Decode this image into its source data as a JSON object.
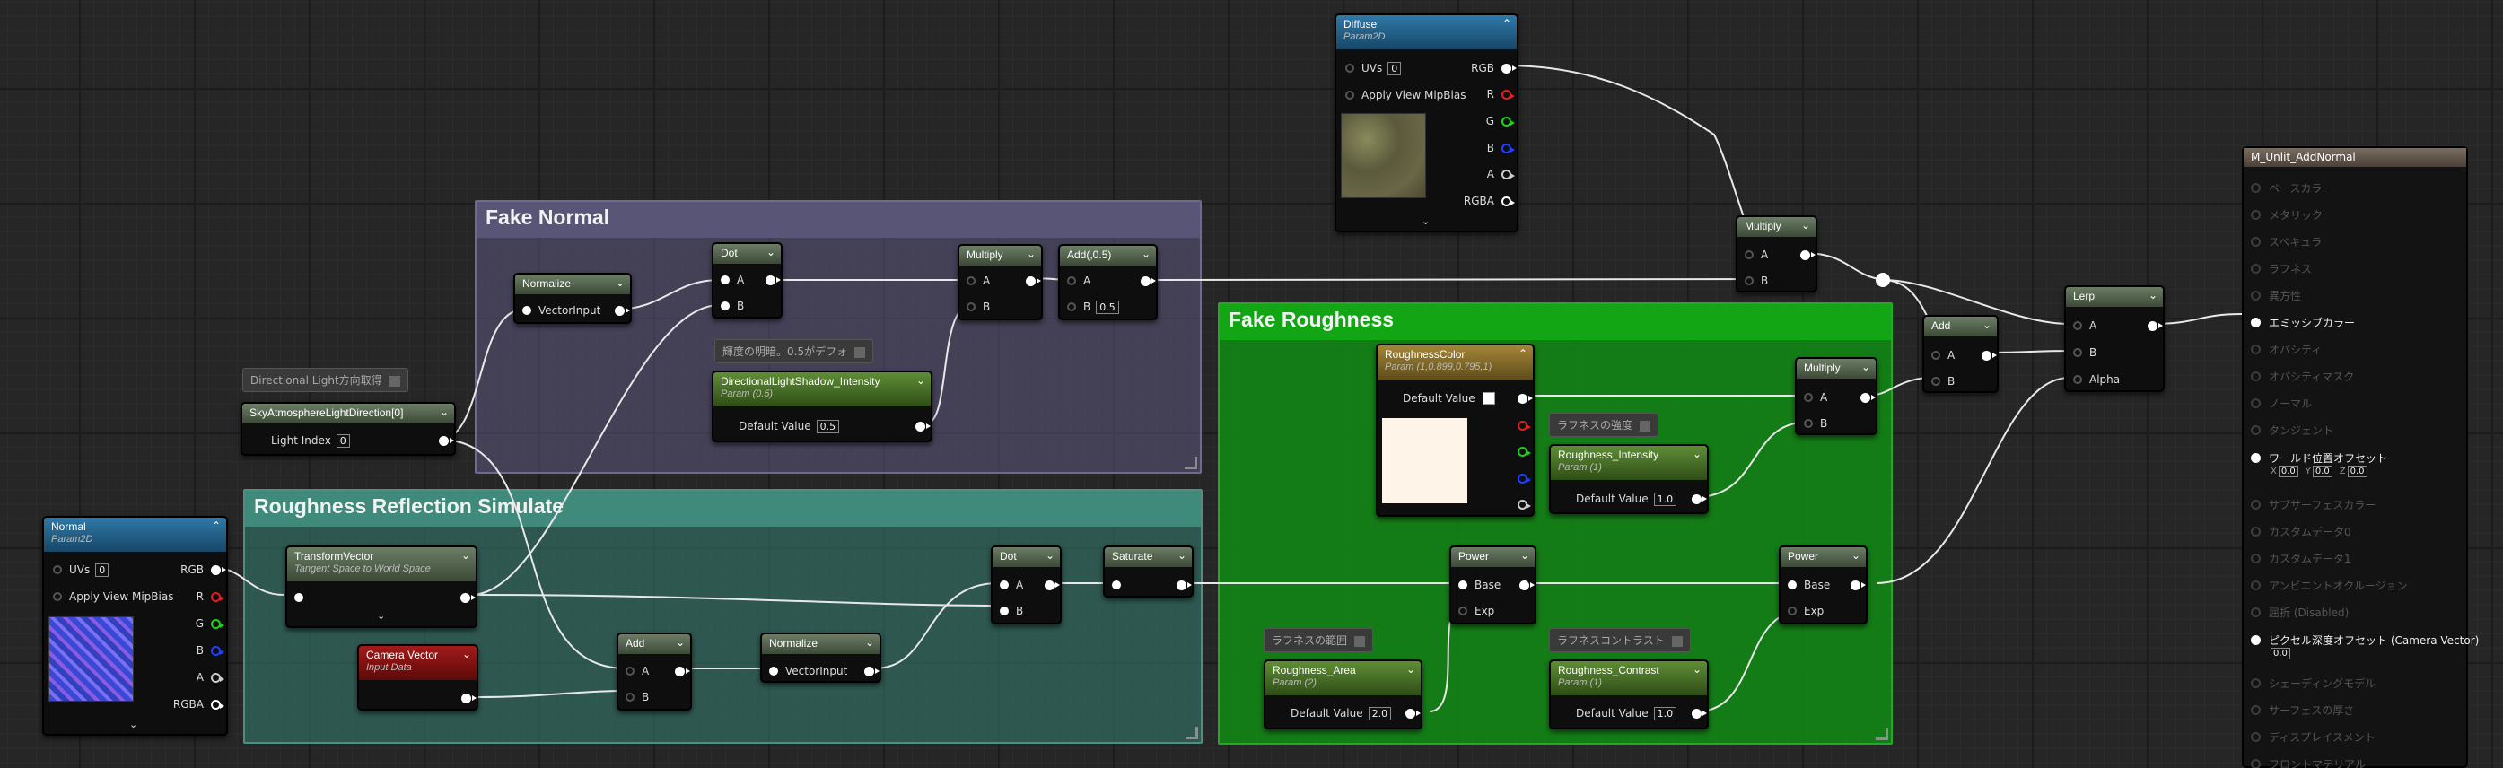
{
  "comments": {
    "fake_normal": "Fake Normal",
    "fake_roughness": "Fake Roughness",
    "roughness_reflection": "Roughness Reflection Simulate"
  },
  "colors": {
    "fake_normal": "#4e4c6a",
    "fake_roughness": "#0f8a10",
    "roughness_reflection": "#2e6e62"
  },
  "notes": {
    "dir_light": "Directional Light方向取得",
    "brightness": "輝度の明暗。0.5がデフォ",
    "roughness_strength": "ラフネスの強度",
    "roughness_range": "ラフネスの範囲",
    "roughness_contrast": "ラフネスコントラスト"
  },
  "nodes": {
    "diffuse": {
      "title": "Diffuse",
      "sub": "Param2D",
      "uvs": "UVs",
      "uvs_val": "0",
      "mip": "Apply View MipBias",
      "rgb": "RGB",
      "r": "R",
      "g": "G",
      "b": "B",
      "a": "A",
      "rgba": "RGBA"
    },
    "normal": {
      "title": "Normal",
      "sub": "Param2D",
      "uvs": "UVs",
      "uvs_val": "0",
      "mip": "Apply View MipBias",
      "rgb": "RGB",
      "r": "R",
      "g": "G",
      "b": "B",
      "a": "A",
      "rgba": "RGBA"
    },
    "normalize1": {
      "title": "Normalize",
      "in": "VectorInput"
    },
    "dot1": {
      "title": "Dot",
      "a": "A",
      "b": "B"
    },
    "multiply1": {
      "title": "Multiply",
      "a": "A",
      "b": "B"
    },
    "add1": {
      "title": "Add(,0.5)",
      "a": "A",
      "b": "B",
      "b_val": "0.5"
    },
    "dls": {
      "title": "DirectionalLightShadow_Intensity",
      "sub": "Param (0.5)",
      "label": "Default Value",
      "val": "0.5"
    },
    "sky": {
      "title": "SkyAtmosphereLightDirection[0]",
      "label": "Light Index",
      "val": "0"
    },
    "multiply_top": {
      "title": "Multiply",
      "a": "A",
      "b": "B"
    },
    "add_right": {
      "title": "Add",
      "a": "A",
      "b": "B"
    },
    "lerp": {
      "title": "Lerp",
      "a": "A",
      "b": "B",
      "alpha": "Alpha"
    },
    "rcolor": {
      "title": "RoughnessColor",
      "sub": "Param (1,0.899,0.795,1)",
      "label": "Default Value"
    },
    "rintensity": {
      "title": "Roughness_Intensity",
      "sub": "Param (1)",
      "label": "Default Value",
      "val": "1.0"
    },
    "multiply_r": {
      "title": "Multiply",
      "a": "A",
      "b": "B"
    },
    "tv": {
      "title": "TransformVector",
      "sub": "Tangent Space to World Space"
    },
    "cam": {
      "title": "Camera Vector",
      "sub": "Input Data"
    },
    "add2": {
      "title": "Add",
      "a": "A",
      "b": "B"
    },
    "normalize2": {
      "title": "Normalize",
      "in": "VectorInput"
    },
    "dot2": {
      "title": "Dot",
      "a": "A",
      "b": "B"
    },
    "saturate": {
      "title": "Saturate"
    },
    "power1": {
      "title": "Power",
      "base": "Base",
      "exp": "Exp"
    },
    "power2": {
      "title": "Power",
      "base": "Base",
      "exp": "Exp"
    },
    "rarea": {
      "title": "Roughness_Area",
      "sub": "Param (2)",
      "label": "Default Value",
      "val": "2.0"
    },
    "rcontrast": {
      "title": "Roughness_Contrast",
      "sub": "Param (1)",
      "label": "Default Value",
      "val": "1.0"
    }
  },
  "result": {
    "title": "M_Unlit_AddNormal",
    "pins": [
      "ベースカラー",
      "メタリック",
      "スペキュラ",
      "ラフネス",
      "異方性",
      "エミッシブカラー",
      "オパシティ",
      "オパシティマスク",
      "ノーマル",
      "タンジェント",
      "ワールド位置オフセット",
      "サブサーフェスカラー",
      "カスタムデータ0",
      "カスタムデータ1",
      "アンビエントオクルージョン",
      "屈折 (Disabled)",
      "ピクセル深度オフセット (Camera Vector)",
      "シェーディングモデル",
      "サーフェスの厚さ",
      "ディスプレイスメント",
      "フロントマテリアル"
    ],
    "wpo": {
      "x": "X",
      "xv": "0.0",
      "y": "Y",
      "yv": "0.0",
      "z": "Z",
      "zv": "0.0"
    },
    "pdo_val": "0.0"
  }
}
